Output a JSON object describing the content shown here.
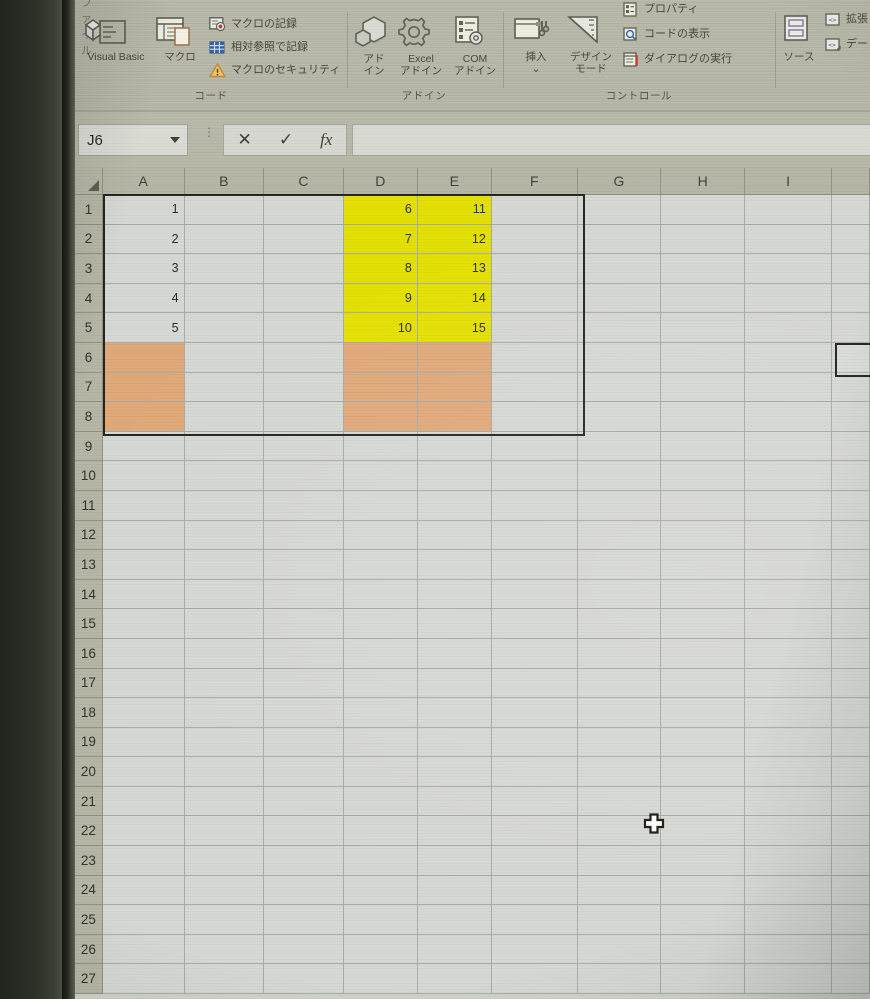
{
  "app": {
    "tab_label_partial": "ファイル",
    "name_box_value": "J6",
    "formula_bar_value": "",
    "formula_cancel_icon": "✕",
    "formula_enter_icon": "✓",
    "formula_function_icon": "fx",
    "name_box_dropdown_icon": "chevron-down-icon",
    "quick_access_dots": "⋮"
  },
  "ribbon": {
    "groups": [
      {
        "id": "code",
        "label": "コード",
        "big_buttons": [
          {
            "id": "visual-basic",
            "label": "Visual Basic",
            "icon": "visual-basic-icon"
          },
          {
            "id": "macros",
            "label": "マクロ",
            "icon": "macro-icon"
          }
        ],
        "small_buttons": [
          {
            "id": "record-macro",
            "label": "マクロの記録",
            "icon": "record-macro-icon"
          },
          {
            "id": "use-relative-references",
            "label": "相対参照で記録",
            "icon": "relative-reference-icon"
          },
          {
            "id": "macro-security",
            "label": "マクロのセキュリティ",
            "icon": "warning-triangle-icon"
          }
        ]
      },
      {
        "id": "add-ins",
        "label": "アドイン",
        "big_buttons": [
          {
            "id": "add-ins",
            "label_line1": "アド",
            "label_line2": "イン",
            "icon": "addins-hex-icon"
          },
          {
            "id": "excel-add-ins",
            "label_line1": "Excel",
            "label_line2": "アドイン",
            "icon": "gear-icon"
          },
          {
            "id": "com-add-ins",
            "label_line1": "COM",
            "label_line2": "アドイン",
            "icon": "com-addin-icon"
          }
        ],
        "small_buttons": []
      },
      {
        "id": "controls",
        "label": "コントロール",
        "big_buttons": [
          {
            "id": "insert-control",
            "label_line1": "挿入",
            "label_line2": "⌄",
            "icon": "insert-control-icon"
          },
          {
            "id": "design-mode",
            "label_line1": "デザイン",
            "label_line2": "モード",
            "icon": "design-mode-icon"
          }
        ],
        "small_buttons": [
          {
            "id": "properties",
            "label": "プロパティ",
            "icon": "properties-icon"
          },
          {
            "id": "view-code",
            "label": "コードの表示",
            "icon": "view-code-icon"
          },
          {
            "id": "run-dialog",
            "label": "ダイアログの実行",
            "icon": "run-dialog-icon"
          }
        ]
      },
      {
        "id": "xml",
        "label": "",
        "big_buttons": [
          {
            "id": "source",
            "label": "ソース",
            "icon": "xml-source-icon"
          }
        ],
        "small_buttons": [
          {
            "id": "expansion-packs",
            "label": "拡張",
            "icon": "expansion-pack-icon"
          },
          {
            "id": "refresh-data",
            "label": "デー",
            "icon": "refresh-data-icon"
          }
        ]
      }
    ]
  },
  "grid": {
    "columns": [
      "A",
      "B",
      "C",
      "D",
      "E",
      "F",
      "G",
      "H",
      "I"
    ],
    "rows": [
      1,
      2,
      3,
      4,
      5,
      6,
      7,
      8,
      9,
      10,
      11,
      12,
      13,
      14,
      15,
      16,
      17,
      18,
      19,
      20,
      21,
      22,
      23,
      24,
      25,
      26,
      27
    ],
    "cells": [
      {
        "row": 1,
        "A": "1",
        "B": "",
        "C": "",
        "D": "6",
        "E": "11",
        "F": ""
      },
      {
        "row": 2,
        "A": "2",
        "B": "",
        "C": "",
        "D": "7",
        "E": "12",
        "F": ""
      },
      {
        "row": 3,
        "A": "3",
        "B": "",
        "C": "",
        "D": "8",
        "E": "13",
        "F": ""
      },
      {
        "row": 4,
        "A": "4",
        "B": "",
        "C": "",
        "D": "9",
        "E": "14",
        "F": ""
      },
      {
        "row": 5,
        "A": "5",
        "B": "",
        "C": "",
        "D": "10",
        "E": "15",
        "F": ""
      },
      {
        "row": 6,
        "A": "",
        "B": "",
        "C": "",
        "D": "",
        "E": "",
        "F": ""
      },
      {
        "row": 7,
        "A": "",
        "B": "",
        "C": "",
        "D": "",
        "E": "",
        "F": ""
      },
      {
        "row": 8,
        "A": "",
        "B": "",
        "C": "",
        "D": "",
        "E": "",
        "F": ""
      }
    ],
    "fill_yellow_range": "D1:E5",
    "fill_orange_cells": "A6:A8, D6:E8",
    "outline_range": "A1:F8",
    "selected_cell": "J6",
    "cursor_icon": "excel-plus-cursor"
  },
  "colors": {
    "yellow_fill": "#e3e000",
    "orange_fill": "#e0a878",
    "ribbon_bg": "#b6b7a6",
    "header_bg": "#b4b5a4",
    "cell_bg": "#d5d7d2",
    "outline": "#23241e"
  }
}
